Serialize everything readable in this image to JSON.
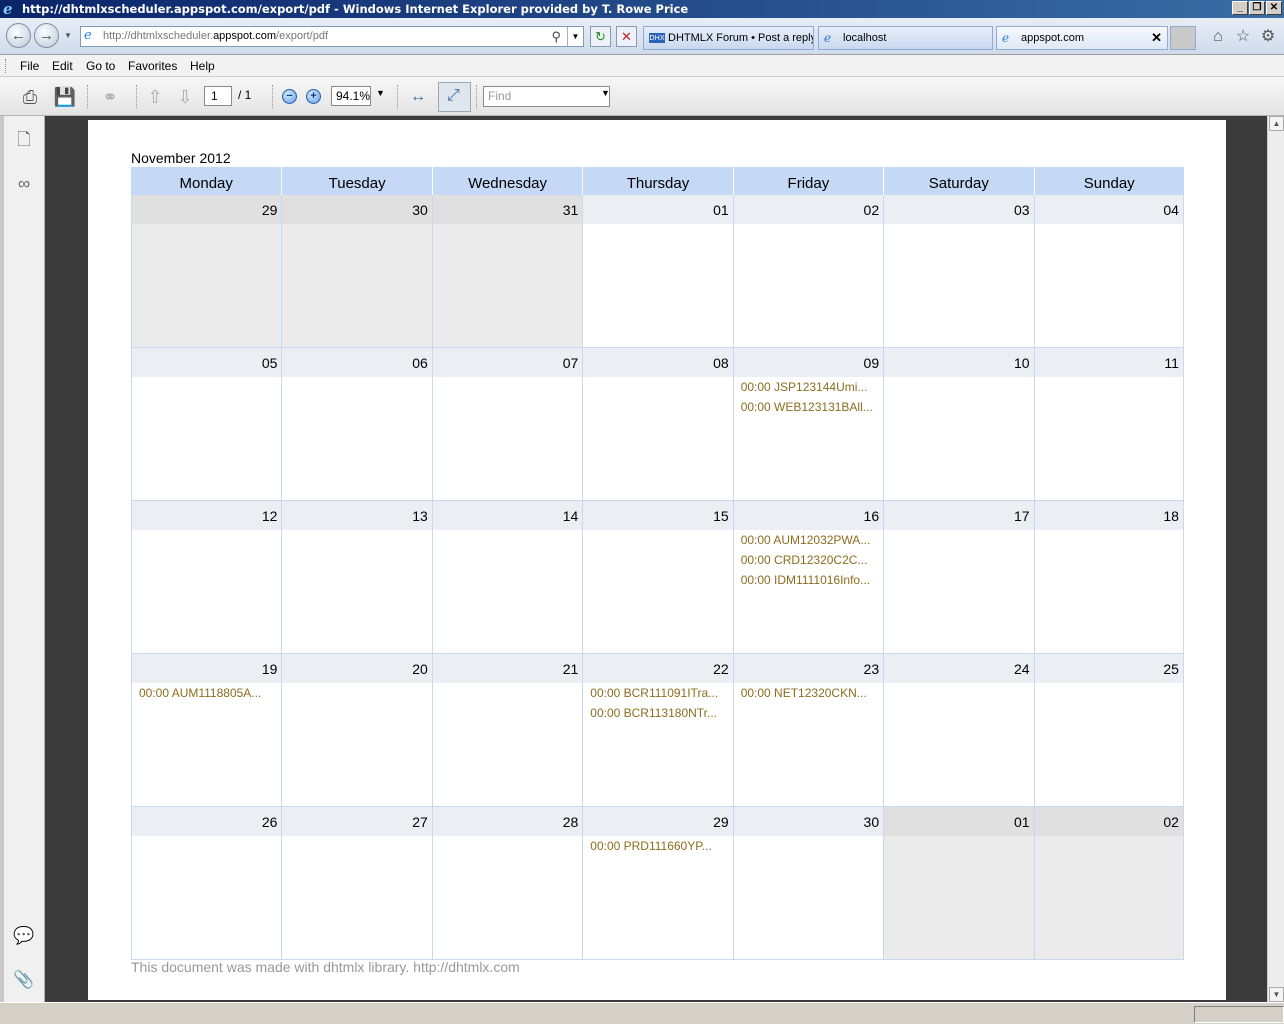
{
  "window": {
    "title": "http://dhtmlxscheduler.appspot.com/export/pdf - Windows Internet Explorer provided by T. Rowe Price",
    "min_btn": "_",
    "max_btn": "❐",
    "close_btn": "✕"
  },
  "address_bar": {
    "url_prefix": "http://dhtmlxscheduler.",
    "url_domain": "appspot.com",
    "url_suffix": "/export/pdf"
  },
  "tabs": [
    {
      "label": "DHTMLX Forum • Post a reply",
      "icon": "dhx-icon"
    },
    {
      "label": "localhost",
      "icon": "ie-icon"
    },
    {
      "label": "appspot.com",
      "icon": "ie-icon"
    }
  ],
  "menu": {
    "file": "File",
    "edit": "Edit",
    "goto": "Go to",
    "favorites": "Favorites",
    "help": "Help"
  },
  "pdf_toolbar": {
    "page_current": "1",
    "page_total": "/ 1",
    "zoom": "94.1%",
    "find_placeholder": "Find"
  },
  "calendar": {
    "month_title": "November 2012",
    "weekdays": [
      "Monday",
      "Tuesday",
      "Wednesday",
      "Thursday",
      "Friday",
      "Saturday",
      "Sunday"
    ],
    "weeks": [
      [
        {
          "day": "29",
          "other": true,
          "events": []
        },
        {
          "day": "30",
          "other": true,
          "events": []
        },
        {
          "day": "31",
          "other": true,
          "events": []
        },
        {
          "day": "01",
          "other": false,
          "events": []
        },
        {
          "day": "02",
          "other": false,
          "events": []
        },
        {
          "day": "03",
          "other": false,
          "events": []
        },
        {
          "day": "04",
          "other": false,
          "events": []
        }
      ],
      [
        {
          "day": "05",
          "other": false,
          "events": []
        },
        {
          "day": "06",
          "other": false,
          "events": []
        },
        {
          "day": "07",
          "other": false,
          "events": []
        },
        {
          "day": "08",
          "other": false,
          "events": []
        },
        {
          "day": "09",
          "other": false,
          "events": [
            "00:00 JSP123144Umi...",
            "00:00 WEB123131BAll..."
          ]
        },
        {
          "day": "10",
          "other": false,
          "events": []
        },
        {
          "day": "11",
          "other": false,
          "events": []
        }
      ],
      [
        {
          "day": "12",
          "other": false,
          "events": []
        },
        {
          "day": "13",
          "other": false,
          "events": []
        },
        {
          "day": "14",
          "other": false,
          "events": []
        },
        {
          "day": "15",
          "other": false,
          "events": []
        },
        {
          "day": "16",
          "other": false,
          "events": [
            "00:00 AUM12032PWA...",
            "00:00 CRD12320C2C...",
            "00:00 IDM1111016Info..."
          ]
        },
        {
          "day": "17",
          "other": false,
          "events": []
        },
        {
          "day": "18",
          "other": false,
          "events": []
        }
      ],
      [
        {
          "day": "19",
          "other": false,
          "events": [
            "00:00 AUM1118805A..."
          ]
        },
        {
          "day": "20",
          "other": false,
          "events": []
        },
        {
          "day": "21",
          "other": false,
          "events": []
        },
        {
          "day": "22",
          "other": false,
          "events": [
            "00:00 BCR111091ITra...",
            "00:00 BCR113180NTr..."
          ]
        },
        {
          "day": "23",
          "other": false,
          "events": [
            "00:00 NET12320CKN..."
          ]
        },
        {
          "day": "24",
          "other": false,
          "events": []
        },
        {
          "day": "25",
          "other": false,
          "events": []
        }
      ],
      [
        {
          "day": "26",
          "other": false,
          "events": []
        },
        {
          "day": "27",
          "other": false,
          "events": []
        },
        {
          "day": "28",
          "other": false,
          "events": []
        },
        {
          "day": "29",
          "other": false,
          "events": [
            "00:00 PRD111660YP..."
          ]
        },
        {
          "day": "30",
          "other": false,
          "events": []
        },
        {
          "day": "01",
          "other": true,
          "events": []
        },
        {
          "day": "02",
          "other": true,
          "events": []
        }
      ]
    ],
    "footer": "This document was made with dhtmlx library. http://dhtmlx.com"
  },
  "colors": {
    "header_bg": "#c5d9f7",
    "event_text": "#8c6d1f",
    "viewer_bg": "#3b3b3b"
  }
}
